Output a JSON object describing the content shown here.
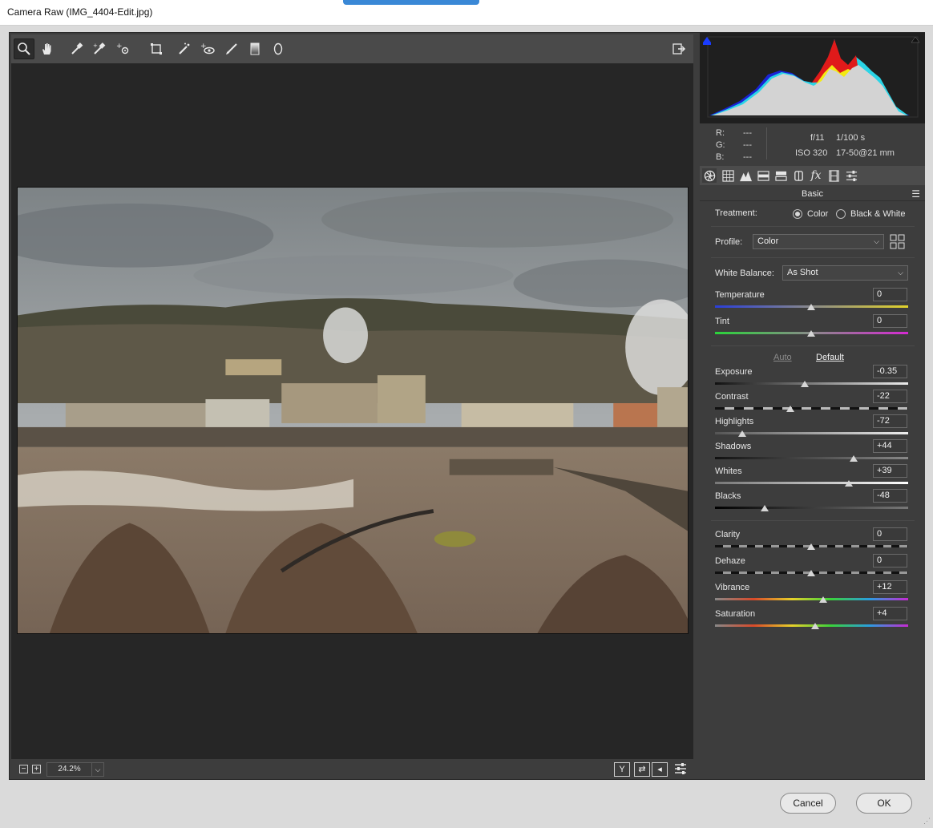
{
  "window": {
    "title": "Camera Raw (IMG_4404-Edit.jpg)"
  },
  "toolbar": {
    "tools": [
      {
        "name": "zoom-tool"
      },
      {
        "name": "hand-tool"
      },
      {
        "name": "white-balance-tool"
      },
      {
        "name": "color-sampler-tool"
      },
      {
        "name": "targeted-adjustment-tool"
      },
      {
        "name": "transform-tool"
      },
      {
        "name": "spot-removal-tool"
      },
      {
        "name": "red-eye-tool"
      },
      {
        "name": "adjustment-brush-tool"
      },
      {
        "name": "graduated-filter-tool"
      },
      {
        "name": "radial-filter-tool"
      }
    ]
  },
  "zoom": {
    "minus": "−",
    "plus": "+",
    "value": "24.2%",
    "dropdown": "⌵"
  },
  "view_buttons": {
    "y": "Y",
    "swap": "⇄",
    "copy": "◂"
  },
  "readout": {
    "r_label": "R:",
    "r_value": "---",
    "g_label": "G:",
    "g_value": "---",
    "b_label": "B:",
    "b_value": "---",
    "aperture": "f/11",
    "shutter": "1/100 s",
    "iso": "ISO 320",
    "lens": "17-50@21 mm"
  },
  "panel": {
    "section_title": "Basic",
    "treatment_label": "Treatment:",
    "treatment_options": [
      "Color",
      "Black & White"
    ],
    "treatment_selected": "Color",
    "profile_label": "Profile:",
    "profile_value": "Color",
    "wb_label": "White Balance:",
    "wb_value": "As Shot",
    "auto_label": "Auto",
    "default_label": "Default",
    "sliders": [
      {
        "label": "Temperature",
        "value": "0"
      },
      {
        "label": "Tint",
        "value": "0"
      },
      {
        "label": "Exposure",
        "value": "-0.35"
      },
      {
        "label": "Contrast",
        "value": "-22"
      },
      {
        "label": "Highlights",
        "value": "-72"
      },
      {
        "label": "Shadows",
        "value": "+44"
      },
      {
        "label": "Whites",
        "value": "+39"
      },
      {
        "label": "Blacks",
        "value": "-48"
      },
      {
        "label": "Clarity",
        "value": "0"
      },
      {
        "label": "Dehaze",
        "value": "0"
      },
      {
        "label": "Vibrance",
        "value": "+12"
      },
      {
        "label": "Saturation",
        "value": "+4"
      }
    ]
  },
  "footer": {
    "cancel_label": "Cancel",
    "ok_label": "OK"
  }
}
